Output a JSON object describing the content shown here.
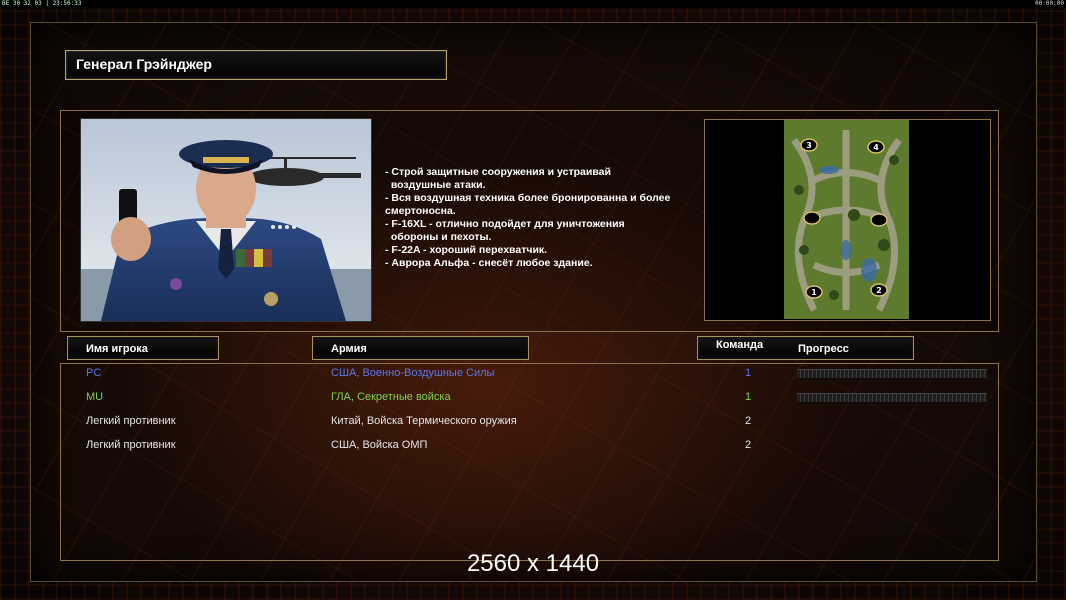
{
  "statusbar": {
    "left": "BE 30 32 03 | 23:50:33",
    "right": "00:00:00"
  },
  "general": {
    "title": "Генерал Грэйнджер"
  },
  "description": [
    "- Строй защитные сооружения и устраивай",
    "  воздушные атаки.",
    "- Вся воздушная техника более бронированна и более",
    "смертоносна.",
    "- F-16XL - отлично подойдет для уничтожения",
    "  обороны и пехоты.",
    "- F-22A - хороший перехватчик.",
    "- Аврора Альфа - снесёт любое здание."
  ],
  "minimap": {
    "slots": [
      "3",
      "4",
      "1",
      "2"
    ]
  },
  "columns": {
    "player": "Имя игрока",
    "army": "Армия",
    "team": "Команда",
    "progress": "Прогресс"
  },
  "players": [
    {
      "name": "PC",
      "army": "США, Военно-Воздушные Силы",
      "team": "1",
      "color": "#5a78e8",
      "progress": 0
    },
    {
      "name": "MU",
      "army": "ГЛА, Секретные войска",
      "team": "1",
      "color": "#7fd24a",
      "progress": 0
    },
    {
      "name": "Легкий противник",
      "army": "Китай, Войска Термического оружия",
      "team": "2",
      "color": "#e6e6e6"
    },
    {
      "name": "Легкий противник",
      "army": "США, Войска ОМП",
      "team": "2",
      "color": "#e6e6e6"
    }
  ],
  "overlay": {
    "resolution": "2560 x 1440"
  }
}
